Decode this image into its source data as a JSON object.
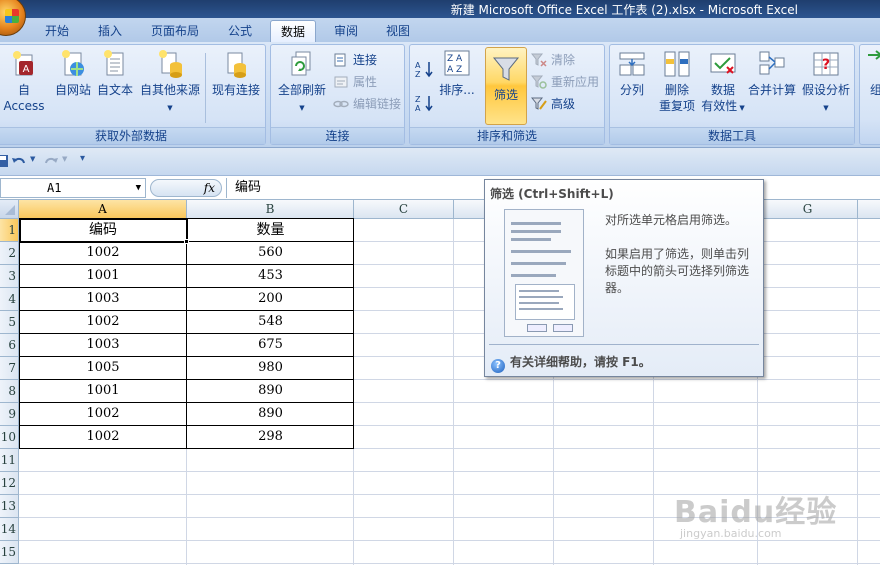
{
  "window": {
    "title": "新建 Microsoft Office Excel 工作表 (2).xlsx - Microsoft Excel"
  },
  "tabs": [
    "开始",
    "插入",
    "页面布局",
    "公式",
    "数据",
    "审阅",
    "视图"
  ],
  "active_tab": "数据",
  "ribbon": {
    "external_data": {
      "label": "获取外部数据",
      "access": "自 Access",
      "web": "自网站",
      "text": "自文本",
      "other": "自其他来源",
      "existing": "现有连接"
    },
    "connections": {
      "label": "连接",
      "refresh_all": "全部刷新",
      "connections": "连接",
      "properties": "属性",
      "edit_links": "编辑链接"
    },
    "sort_filter": {
      "label": "排序和筛选",
      "sort": "排序...",
      "filter": "筛选",
      "clear": "清除",
      "reapply": "重新应用",
      "advanced": "高级"
    },
    "data_tools": {
      "label": "数据工具",
      "text_to_columns": "分列",
      "remove_dup_1": "删除",
      "remove_dup_2": "重复项",
      "validation_1": "数据",
      "validation_2": "有效性",
      "consolidate": "合并计算",
      "what_if": "假设分析",
      "next": "组"
    }
  },
  "formula_bar": {
    "name_box": "A1",
    "fx": "fx",
    "formula": "编码"
  },
  "columns": [
    "A",
    "B",
    "C",
    "D",
    "E",
    "F",
    "G"
  ],
  "rows": [
    "1",
    "2",
    "3",
    "4",
    "5",
    "6",
    "7",
    "8",
    "9",
    "10",
    "11",
    "12",
    "13",
    "14",
    "15"
  ],
  "table": {
    "headers": [
      "编码",
      "数量"
    ],
    "data": [
      [
        "1002",
        "560"
      ],
      [
        "1001",
        "453"
      ],
      [
        "1003",
        "200"
      ],
      [
        "1002",
        "548"
      ],
      [
        "1003",
        "675"
      ],
      [
        "1005",
        "980"
      ],
      [
        "1001",
        "890"
      ],
      [
        "1002",
        "890"
      ],
      [
        "1002",
        "298"
      ]
    ]
  },
  "tooltip": {
    "title": "筛选 (Ctrl+Shift+L)",
    "line1": "对所选单元格启用筛选。",
    "line2": "如果启用了筛选，则单击列标题中的箭头可选择列筛选器。",
    "help": "有关详细帮助，请按 F1。"
  },
  "watermark": {
    "brand": "Baidu经验",
    "url": "jingyan.baidu.com"
  }
}
